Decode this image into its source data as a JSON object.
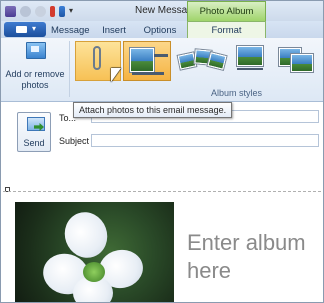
{
  "window": {
    "title": "New Messa",
    "contextual_group": "Photo Album Tools"
  },
  "tabs": [
    {
      "label": "Message"
    },
    {
      "label": "Insert"
    },
    {
      "label": "Options"
    },
    {
      "label": "Format"
    }
  ],
  "ribbon": {
    "add_remove_photos": "Add or remove photos",
    "group_label": "Album styles"
  },
  "tooltip": {
    "text": "Attach photos to this email message."
  },
  "header": {
    "send_label": "Send",
    "to_label": "To...",
    "subject_label": "Subject",
    "to_value": "",
    "subject_value": ""
  },
  "body": {
    "album_placeholder": "Enter album here"
  },
  "colors": {
    "contextual_tab": "#9fd46b",
    "selected_style": "#f5b342",
    "ribbon_bg": "#dde8f5"
  }
}
